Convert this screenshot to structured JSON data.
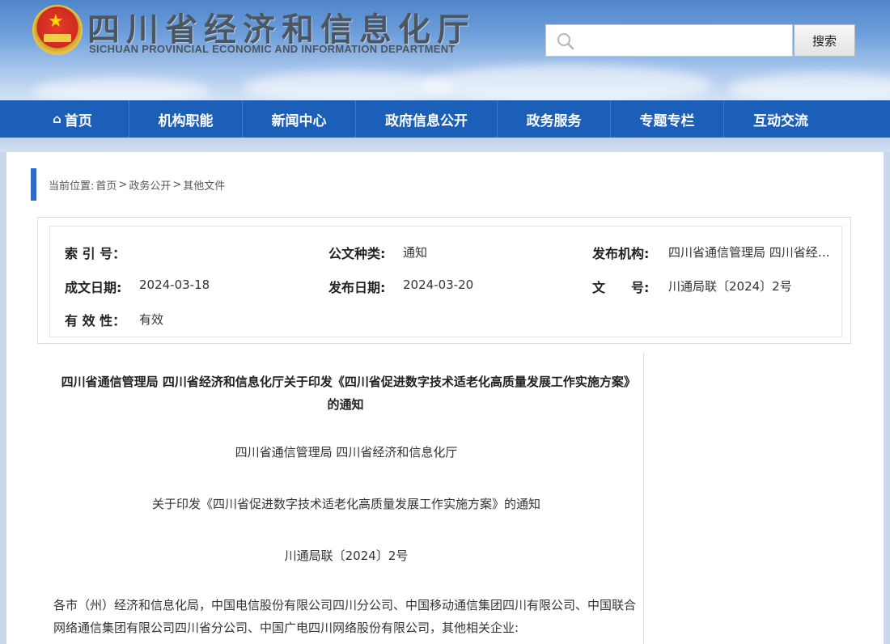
{
  "header": {
    "title": "四川省经济和信息化厅",
    "subtitle": "SICHUAN PROVINCIAL ECONOMIC AND INFORMATION DEPARTMENT",
    "search_placeholder": "",
    "search_button": "搜索"
  },
  "nav": {
    "items": [
      "首页",
      "机构职能",
      "新闻中心",
      "政府信息公开",
      "政务服务",
      "专题专栏",
      "互动交流"
    ]
  },
  "breadcrumb": {
    "prefix": "当前位置:",
    "items": [
      "首页",
      "政务公开",
      "其他文件"
    ],
    "separator": ">"
  },
  "info": {
    "index_label": "索 引 号：",
    "index_value": "",
    "type_label": "公文种类:",
    "type_value": "通知",
    "org_label": "发布机构:",
    "org_value": "四川省通信管理局 四川省经…",
    "created_label": "成文日期:",
    "created_value": "2024-03-18",
    "published_label": "发布日期:",
    "published_value": "2024-03-20",
    "docno_label": "文　　号:",
    "docno_value": "川通局联〔2024〕2号",
    "valid_label": "有 效 性：",
    "valid_value": "有效"
  },
  "doc": {
    "title": "四川省通信管理局 四川省经济和信息化厅关于印发《四川省促进数字技术适老化高质量发展工作实施方案》的通知",
    "issuer": "四川省通信管理局 四川省经济和信息化厅",
    "subject": "关于印发《四川省促进数字技术适老化高质量发展工作实施方案》的通知",
    "number": "川通局联〔2024〕2号",
    "recipients": "各市（州）经济和信息化局，中国电信股份有限公司四川分公司、中国移动通信集团四川有限公司、中国联合网络通信集团有限公司四川省分公司、中国广电四川网络股份有限公司，其他相关企业:"
  },
  "colors": {
    "nav_bg": "#1c5fb9",
    "accent": "#2c6cc4",
    "emblem_red": "#d02a1f",
    "emblem_gold": "#e8c34a"
  }
}
